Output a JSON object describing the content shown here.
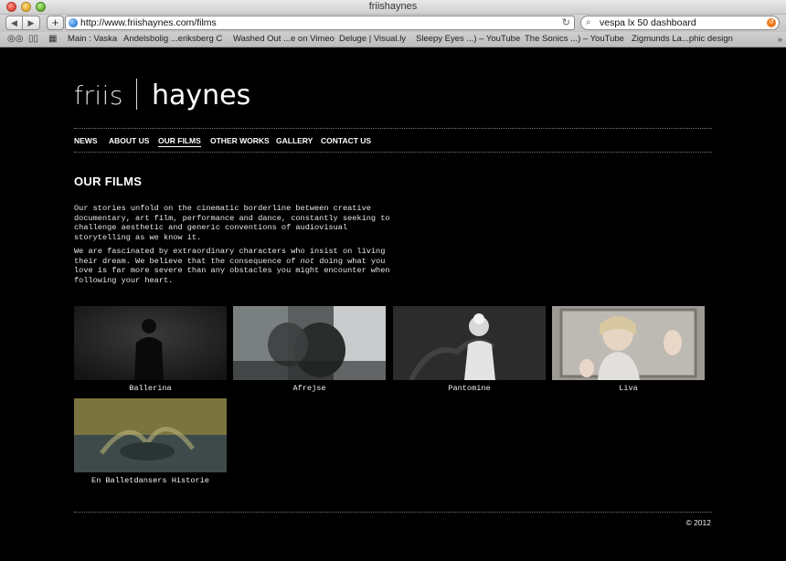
{
  "browser": {
    "window_title": "friishaynes",
    "url": "http://www.friishaynes.com/films",
    "search_value": "vespa lx 50 dashboard",
    "bookmarks": [
      "Main : Vaska",
      "Andelsbolig ...eriksberg C",
      "Washed Out ...e on Vimeo",
      "Deluge | Visual.ly",
      "Sleepy Eyes ...) – YouTube",
      "The Sonics ...) – YouTube",
      "Zigmunds La...phic design"
    ]
  },
  "site": {
    "logo_left": "friis",
    "logo_right": "haynes",
    "nav": [
      "NEWS",
      "ABOUT US",
      "OUR FILMS",
      "OTHER WORKS",
      "GALLERY",
      "CONTACT US"
    ],
    "active_nav": "OUR FILMS",
    "page_title": "OUR FILMS",
    "intro_p1": "Our stories unfold on the cinematic borderline between creative documentary, art film, performance and dance, constantly seeking to challenge aesthetic and generic conventions of audiovisual storytelling as we know it.",
    "intro_p2_before": "We are fascinated by extraordinary characters who insist on living their dream. We believe that the consequence of ",
    "intro_p2_em": "not",
    "intro_p2_after": " doing what you love is far more severe than any obstacles you might encounter when following your heart.",
    "films": [
      {
        "title": "Ballerina"
      },
      {
        "title": "Afrejse"
      },
      {
        "title": "Pantomine"
      },
      {
        "title": "Liva"
      },
      {
        "title": "En Balletdansers Historie"
      }
    ],
    "copyright": "© 2012"
  }
}
